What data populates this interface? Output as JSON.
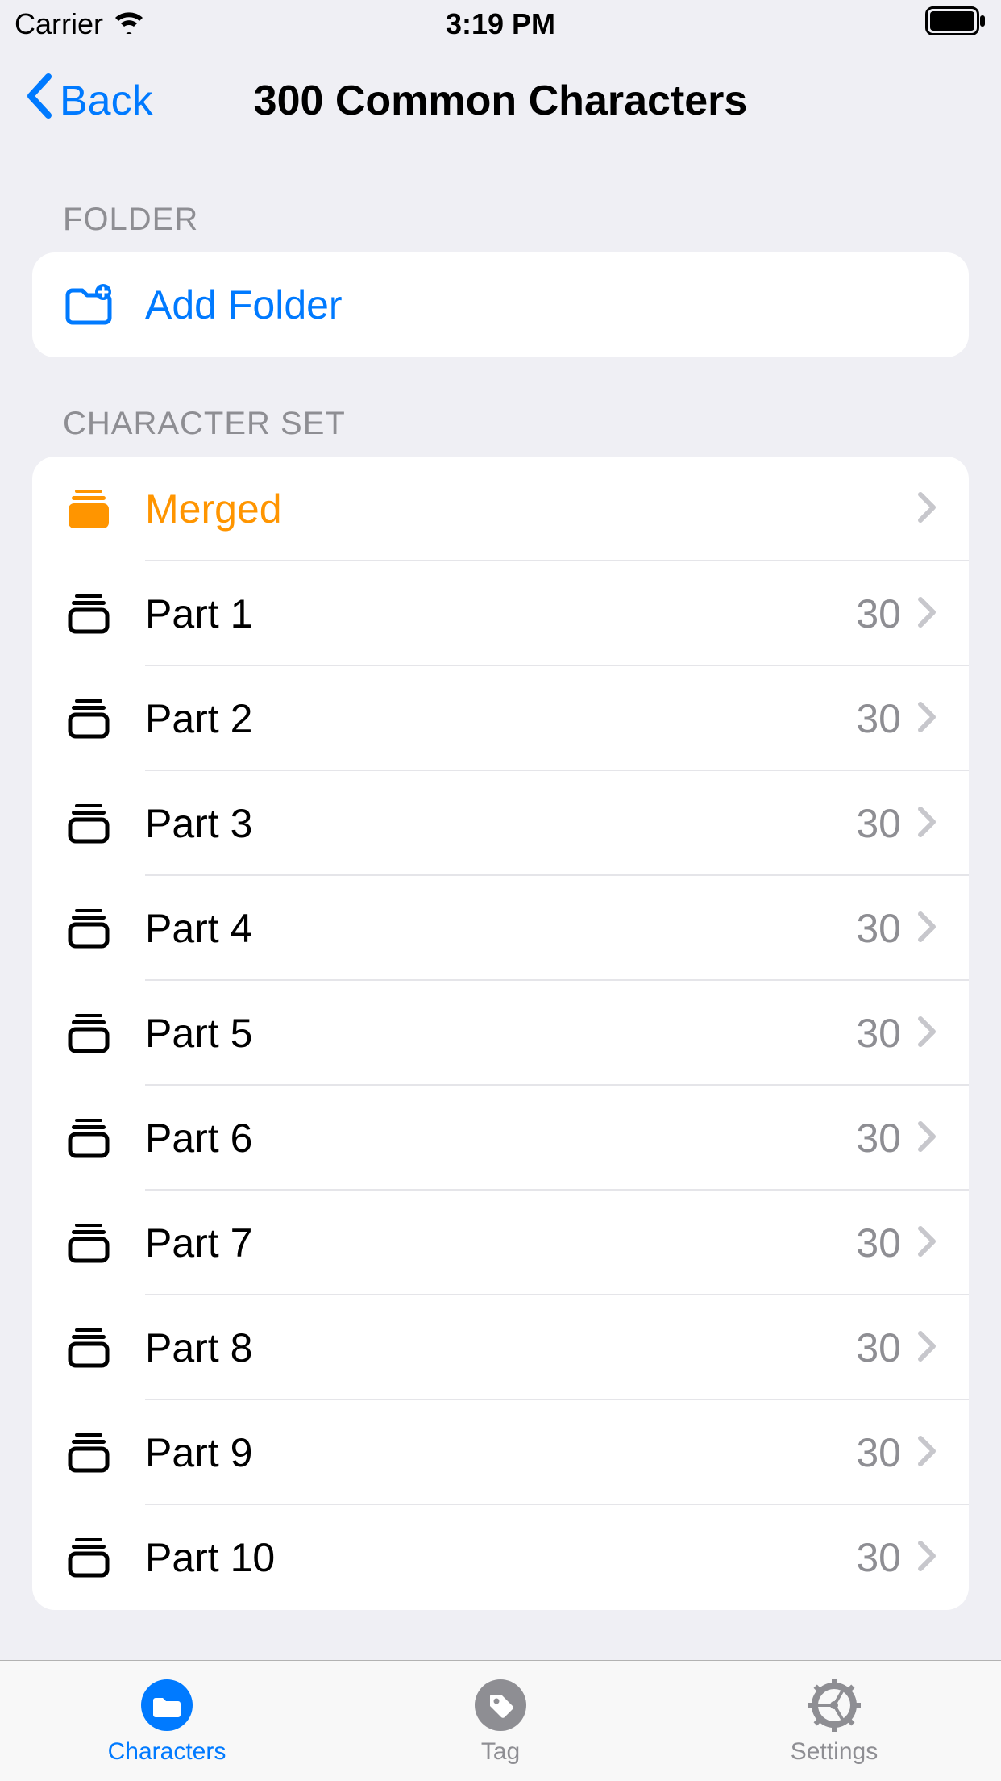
{
  "status_bar": {
    "carrier": "Carrier",
    "time": "3:19 PM"
  },
  "nav": {
    "back_label": "Back",
    "title": "300 Common Characters"
  },
  "sections": {
    "folder": {
      "header": "FOLDER",
      "add_folder_label": "Add Folder"
    },
    "character_set": {
      "header": "CHARACTER SET",
      "merged_label": "Merged",
      "items": [
        {
          "label": "Part 1",
          "count": "30"
        },
        {
          "label": "Part 2",
          "count": "30"
        },
        {
          "label": "Part 3",
          "count": "30"
        },
        {
          "label": "Part 4",
          "count": "30"
        },
        {
          "label": "Part 5",
          "count": "30"
        },
        {
          "label": "Part 6",
          "count": "30"
        },
        {
          "label": "Part 7",
          "count": "30"
        },
        {
          "label": "Part 8",
          "count": "30"
        },
        {
          "label": "Part 9",
          "count": "30"
        },
        {
          "label": "Part 10",
          "count": "30"
        }
      ]
    }
  },
  "tabs": {
    "characters": "Characters",
    "tag": "Tag",
    "settings": "Settings"
  }
}
